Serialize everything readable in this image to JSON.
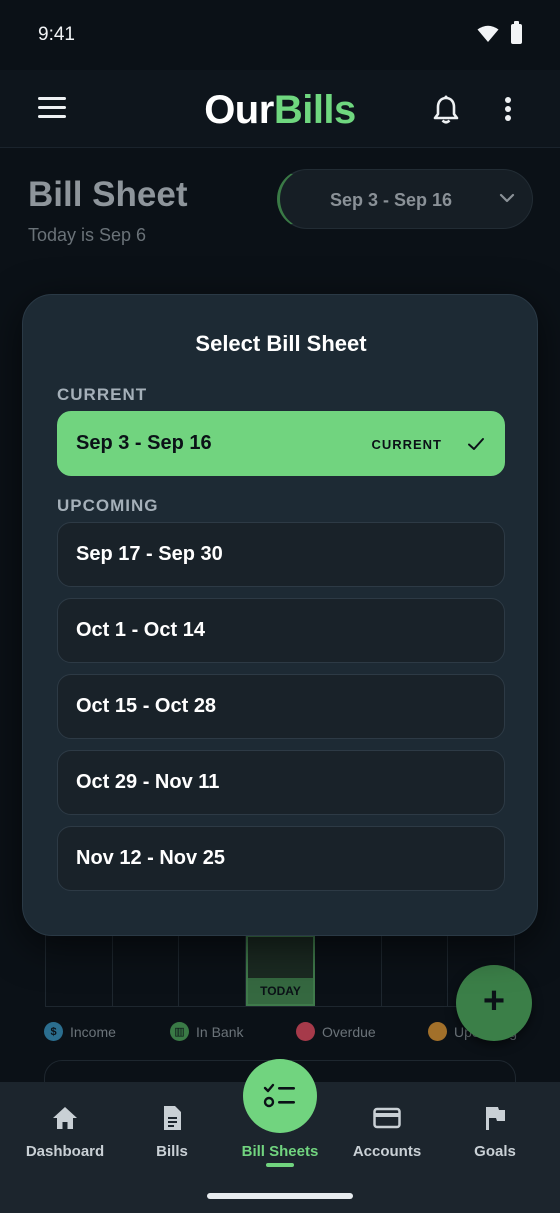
{
  "status_bar": {
    "time": "9:41"
  },
  "app_bar": {
    "logo_our": "Our",
    "logo_bills": "Bills"
  },
  "header": {
    "title": "Bill Sheet",
    "subtitle": "Today is Sep 6",
    "selected_range": "Sep 3 - Sep 16"
  },
  "modal": {
    "title": "Select Bill Sheet",
    "current_section": "CURRENT",
    "current_item": {
      "label": "Sep 3 - Sep 16",
      "badge": "CURRENT"
    },
    "upcoming_section": "UPCOMING",
    "upcoming_items": [
      {
        "label": "Sep 17 - Sep 30"
      },
      {
        "label": "Oct 1 - Oct 14"
      },
      {
        "label": "Oct 15 - Oct 28"
      },
      {
        "label": "Oct 29 - Nov 11"
      },
      {
        "label": "Nov 12 - Nov 25"
      }
    ]
  },
  "calendar": {
    "today_label": "TODAY"
  },
  "legend": [
    {
      "label": "Income",
      "color": "#2b6e8f",
      "glyph": "$"
    },
    {
      "label": "In Bank",
      "color": "#3a7a46",
      "glyph": "▥"
    },
    {
      "label": "Overdue",
      "color": "#a63a4a",
      "glyph": ""
    },
    {
      "label": "Upcoming",
      "color": "#a2702a",
      "glyph": ""
    }
  ],
  "fab": {
    "label": "+"
  },
  "bottom_nav": [
    {
      "label": "Dashboard",
      "icon": "home-icon"
    },
    {
      "label": "Bills",
      "icon": "document-icon"
    },
    {
      "label": "Bill Sheets",
      "icon": "checklist-icon",
      "active": true
    },
    {
      "label": "Accounts",
      "icon": "credit-card-icon"
    },
    {
      "label": "Goals",
      "icon": "flag-icon"
    }
  ],
  "colors": {
    "accent": "#71d47f",
    "background": "#0b1117",
    "modal": "#1d2a34"
  }
}
